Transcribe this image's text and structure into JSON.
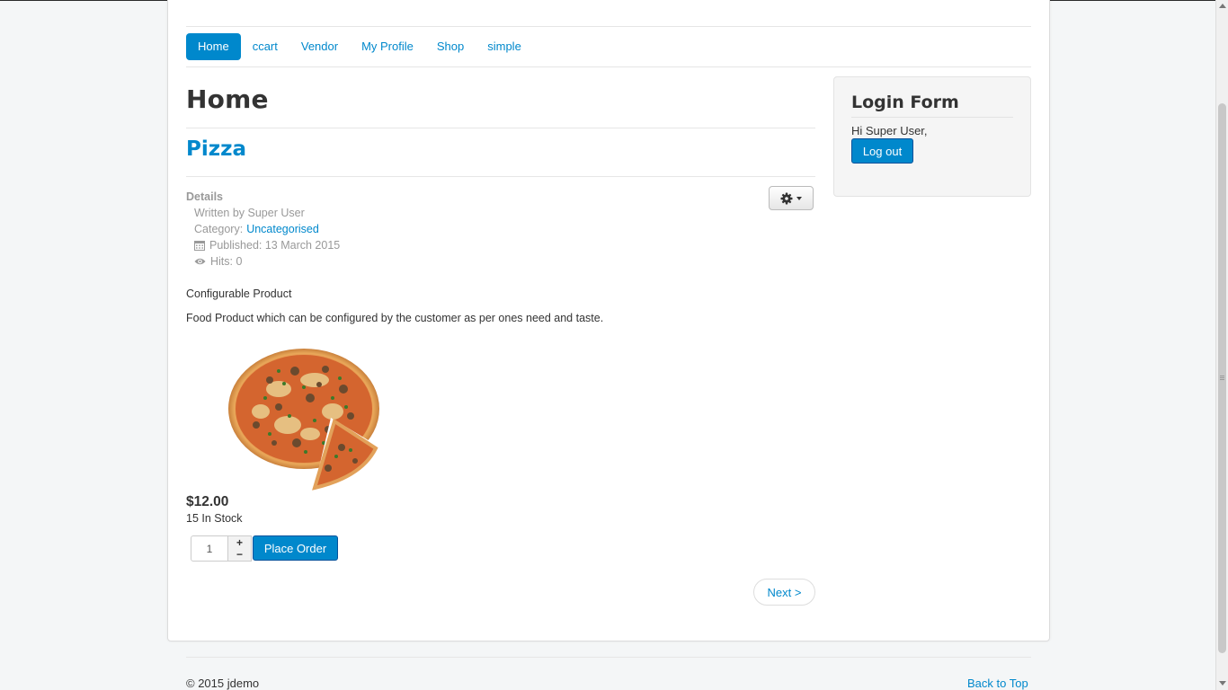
{
  "nav": {
    "items": [
      {
        "label": "Home",
        "active": true
      },
      {
        "label": "ccart",
        "active": false
      },
      {
        "label": "Vendor",
        "active": false
      },
      {
        "label": "My Profile",
        "active": false
      },
      {
        "label": "Shop",
        "active": false
      },
      {
        "label": "simple",
        "active": false
      }
    ]
  },
  "page": {
    "header": "Home",
    "item_title": "Pizza"
  },
  "details": {
    "title": "Details",
    "written_by": "Written by Super User",
    "category_prefix": "Category:",
    "category_link": "Uncategorised",
    "published": "Published: 13 March 2015",
    "hits": "Hits: 0"
  },
  "content": {
    "subtitle": "Configurable Product",
    "description": "Food Product which can be configured by the customer as per ones need and taste."
  },
  "product": {
    "price": "$12.00",
    "stock": "15 In Stock",
    "quantity": "1",
    "plus": "+",
    "minus": "−",
    "place_order_label": "Place Order"
  },
  "pagination": {
    "next_label": "Next >"
  },
  "login": {
    "title": "Login Form",
    "greeting": "Hi Super User,",
    "logout_label": "Log out"
  },
  "footer": {
    "copyright": "© 2015 jdemo",
    "back_to_top": "Back to Top"
  },
  "colors": {
    "accent": "#0088cc",
    "muted": "#999999",
    "background": "#f4f6f7"
  },
  "icons": [
    "gear-icon",
    "calendar-icon",
    "eye-icon",
    "pizza-image"
  ]
}
